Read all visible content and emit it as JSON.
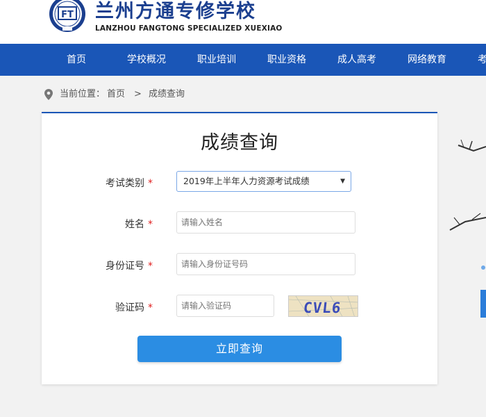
{
  "header": {
    "title": "兰州方通专修学校",
    "subtitle": "LANZHOU FANGTONG SPECIALIZED XUEXIAO",
    "emblem_text": "FT"
  },
  "nav": {
    "items": [
      "首页",
      "学校概况",
      "职业培训",
      "职业资格",
      "成人高考",
      "网络教育",
      "考"
    ]
  },
  "breadcrumb": {
    "prefix": "当前位置：",
    "home": "首页",
    "separator": ">",
    "current": "成绩查询"
  },
  "form": {
    "title": "成绩查询",
    "required_mark": "*",
    "exam_type_label": "考试类别",
    "exam_type_value": "2019年上半年人力资源考试成绩",
    "name_label": "姓名",
    "name_placeholder": "请输入姓名",
    "id_label": "身份证号",
    "id_placeholder": "请输入身份证号码",
    "captcha_label": "验证码",
    "captcha_placeholder": "请输入验证码",
    "captcha_text": "CVL6",
    "submit_label": "立即查询"
  },
  "colors": {
    "brand_blue": "#1a56b7",
    "button_blue": "#2b8de3",
    "required_red": "#e02020"
  }
}
